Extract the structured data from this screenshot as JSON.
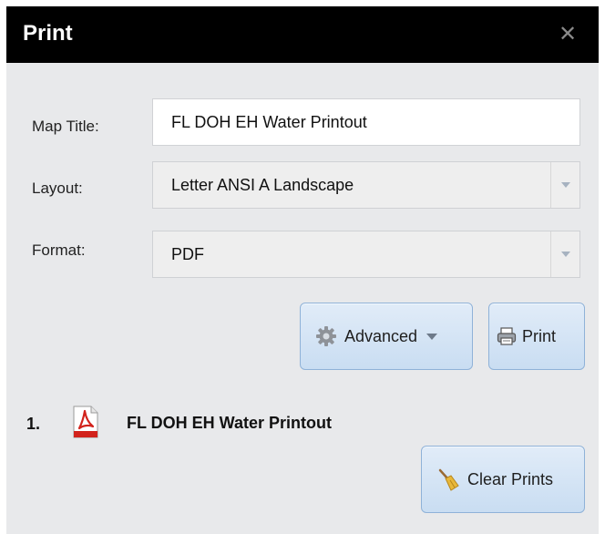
{
  "dialog": {
    "title": "Print",
    "close_icon": "close-icon",
    "close_glyph": "✕"
  },
  "form": {
    "map_title": {
      "label": "Map Title:",
      "value": "FL DOH EH Water Printout"
    },
    "layout": {
      "label": "Layout:",
      "selected": "Letter ANSI A Landscape"
    },
    "format": {
      "label": "Format:",
      "selected": "PDF"
    }
  },
  "buttons": {
    "advanced": {
      "label": "Advanced",
      "icon": "gear-icon"
    },
    "print": {
      "label": "Print",
      "icon": "printer-icon"
    },
    "clear_prints": {
      "label": "Clear Prints",
      "icon": "broom-icon"
    }
  },
  "results": [
    {
      "number": "1.",
      "icon": "pdf-icon",
      "title": "FL DOH EH Water Printout"
    }
  ],
  "colors": {
    "titlebar": "#000000",
    "panel": "#e8e9eb",
    "button_border": "#8fb2d8",
    "pdf_red": "#d2231c"
  }
}
